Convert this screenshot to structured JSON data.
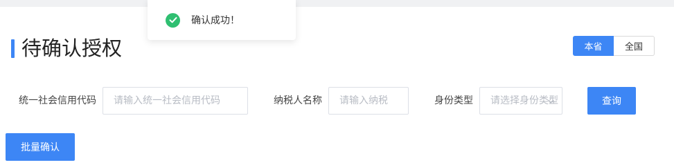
{
  "toast": {
    "message": "确认成功！",
    "icon": "check-circle-icon",
    "color": "#2fbf71"
  },
  "page": {
    "title": "待确认授权"
  },
  "scope": {
    "options": [
      "本省",
      "全国"
    ],
    "selected": "本省"
  },
  "filters": {
    "credit_code": {
      "label": "统一社会信用代码",
      "placeholder": "请输入统一社会信用代码"
    },
    "taxpayer_name": {
      "label": "纳税人名称",
      "placeholder": "请输入纳税"
    },
    "identity_type": {
      "label": "身份类型",
      "placeholder": "请选择身份类型"
    }
  },
  "actions": {
    "search": "查询",
    "batch_confirm": "批量确认"
  },
  "colors": {
    "accent": "#3d86f5"
  }
}
